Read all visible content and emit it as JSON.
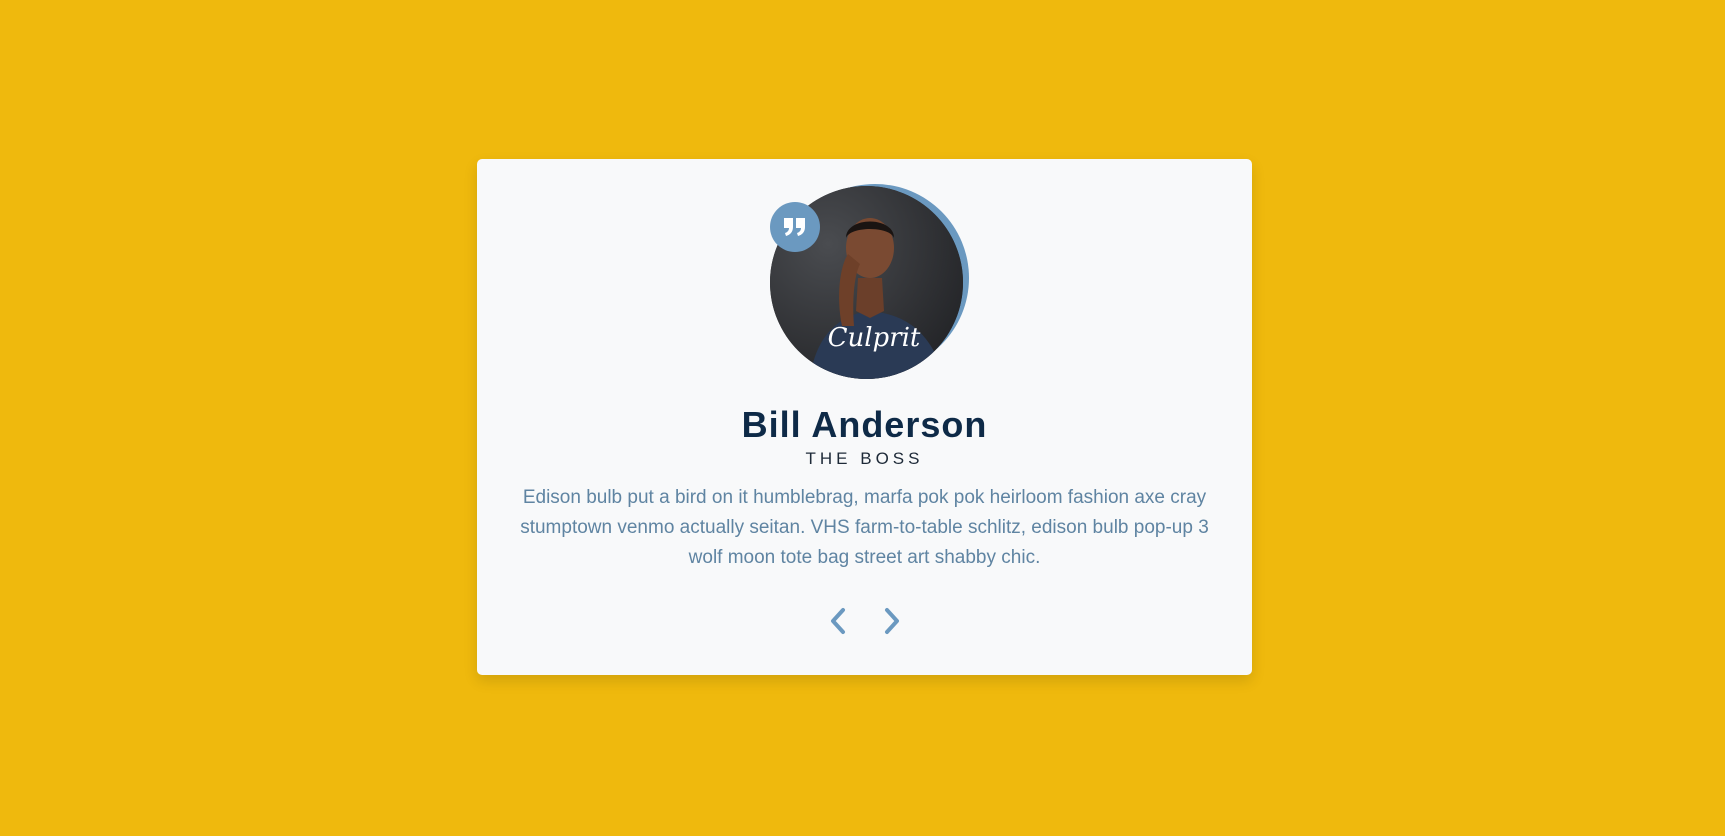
{
  "colors": {
    "background": "#efb90d",
    "card": "#f8f9fa",
    "accent": "#6b99c0",
    "name": "#0e2a47",
    "text": "#5f84a2"
  },
  "testimonial": {
    "avatar_alt": "Bill Anderson",
    "shirt_text": "Culprit",
    "name": "Bill Anderson",
    "role": "THE BOSS",
    "text": "Edison bulb put a bird on it humblebrag, marfa pok pok heirloom fashion axe cray stumptown venmo actually seitan. VHS farm-to-table schlitz, edison bulb pop-up 3 wolf moon tote bag street art shabby chic."
  },
  "icons": {
    "quote": "quote-icon",
    "prev": "chevron-left-icon",
    "next": "chevron-right-icon"
  },
  "nav": {
    "prev_label": "Previous",
    "next_label": "Next"
  }
}
